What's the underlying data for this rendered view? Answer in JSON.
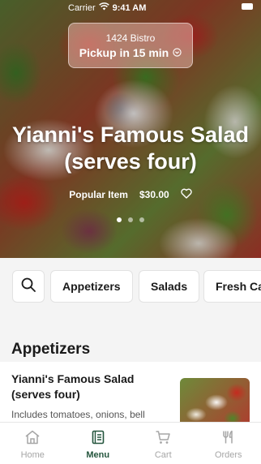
{
  "status_bar": {
    "carrier": "Carrier",
    "time": "9:41 AM",
    "wifi_icon": "wifi-icon",
    "battery_icon": "battery-icon"
  },
  "pickup": {
    "location": "1424 Bistro",
    "time_label": "Pickup in 15 min",
    "icon": "chevron-down-circle-icon"
  },
  "hero": {
    "title": "Yianni's Famous Salad (serves four)",
    "tag": "Popular Item",
    "price": "$30.00",
    "favorite_icon": "heart-icon",
    "page_count": 3,
    "active_page": 1
  },
  "categories": {
    "search_icon": "search-icon",
    "chips": [
      "Appetizers",
      "Salads",
      "Fresh Ca"
    ]
  },
  "menu": {
    "section_title": "Appetizers",
    "items": [
      {
        "name": "Yianni's Famous Salad (serves four)",
        "description": "Includes tomatoes, onions, bell"
      }
    ]
  },
  "tab_bar": {
    "tabs": [
      {
        "label": "Home",
        "icon": "home-icon",
        "active": false
      },
      {
        "label": "Menu",
        "icon": "menu-book-icon",
        "active": true
      },
      {
        "label": "Cart",
        "icon": "cart-icon",
        "active": false
      },
      {
        "label": "Orders",
        "icon": "utensils-icon",
        "active": false
      }
    ]
  },
  "colors": {
    "accent": "#24553d",
    "inactive": "#a6a6a6"
  }
}
